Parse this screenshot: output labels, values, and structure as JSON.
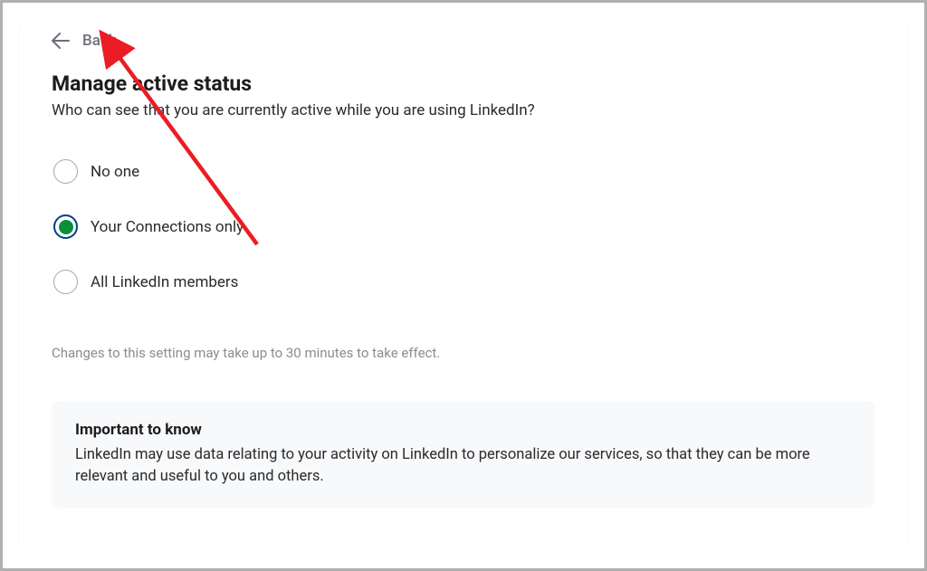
{
  "back": {
    "label": "Back"
  },
  "title": "Manage active status",
  "subtitle": "Who can see that you are currently active while you are using LinkedIn?",
  "options": [
    {
      "label": "No one",
      "selected": false
    },
    {
      "label": "Your Connections only",
      "selected": true
    },
    {
      "label": "All LinkedIn members",
      "selected": false
    }
  ],
  "note": "Changes to this setting may take up to 30 minutes to take effect.",
  "info": {
    "title": "Important to know",
    "body": "LinkedIn may use data relating to your activity on LinkedIn to personalize our services, so that they can be more relevant and useful to you and others."
  },
  "colors": {
    "radio_selected_border": "#004182",
    "radio_selected_fill": "#0a8f3c",
    "annotation_arrow": "#eb1c24"
  }
}
